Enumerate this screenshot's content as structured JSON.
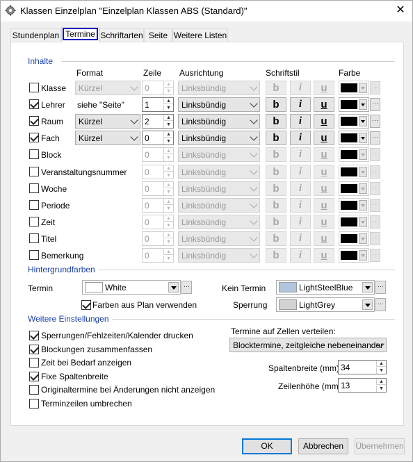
{
  "window": {
    "title": "Klassen Einzelplan \"Einzelplan Klassen ABS (Standard)\"",
    "close_glyph": "✕"
  },
  "tabs": [
    "Stundenplan",
    "Termine",
    "Schriftarten",
    "Seite",
    "Weitere Listen"
  ],
  "inhalte": {
    "group_title": "Inhalte",
    "headers": {
      "format": "Format",
      "zeile": "Zeile",
      "ausrichtung": "Ausrichtung",
      "schriftstil": "Schriftstil",
      "farbe": "Farbe"
    },
    "style_glyphs": {
      "bold": "b",
      "italic": "i",
      "underline": "u"
    },
    "dots": "···",
    "rows": [
      {
        "label": "Klasse",
        "checked": false,
        "format": "Kürzel",
        "format_type": "combo",
        "zeile": "0",
        "ausrichtung": "Linksbündig"
      },
      {
        "label": "Lehrer",
        "checked": true,
        "format": "siehe \"Seite\"",
        "format_type": "text",
        "zeile": "1",
        "ausrichtung": "Linksbündig"
      },
      {
        "label": "Raum",
        "checked": true,
        "format": "Kürzel",
        "format_type": "combo",
        "zeile": "2",
        "ausrichtung": "Linksbündig"
      },
      {
        "label": "Fach",
        "checked": true,
        "format": "Kürzel",
        "format_type": "combo",
        "zeile": "0",
        "ausrichtung": "Linksbündig"
      },
      {
        "label": "Block",
        "checked": false,
        "format": "",
        "format_type": "none",
        "zeile": "0",
        "ausrichtung": "Linksbündig"
      },
      {
        "label": "Veranstaltungsnummer",
        "checked": false,
        "format": "",
        "format_type": "none",
        "zeile": "0",
        "ausrichtung": "Linksbündig"
      },
      {
        "label": "Woche",
        "checked": false,
        "format": "",
        "format_type": "none",
        "zeile": "0",
        "ausrichtung": "Linksbündig"
      },
      {
        "label": "Periode",
        "checked": false,
        "format": "",
        "format_type": "none",
        "zeile": "0",
        "ausrichtung": "Linksbündig"
      },
      {
        "label": "Zeit",
        "checked": false,
        "format": "",
        "format_type": "none",
        "zeile": "0",
        "ausrichtung": "Linksbündig"
      },
      {
        "label": "Titel",
        "checked": false,
        "format": "",
        "format_type": "none",
        "zeile": "0",
        "ausrichtung": "Linksbündig"
      },
      {
        "label": "Bemerkung",
        "checked": false,
        "format": "",
        "format_type": "none",
        "zeile": "0",
        "ausrichtung": "Linksbündig"
      }
    ]
  },
  "hintergrund": {
    "group_title": "Hintergrundfarben",
    "termin_label": "Termin",
    "termin_value": "White",
    "termin_color": "#ffffff",
    "kein_termin_label": "Kein Termin",
    "kein_termin_value": "LightSteelBlue",
    "kein_termin_color": "#b0c4de",
    "sperrung_label": "Sperrung",
    "sperrung_value": "LightGrey",
    "sperrung_color": "#d3d3d3",
    "farben_checkbox": "Farben aus Plan verwenden",
    "farben_checked": true
  },
  "weitere": {
    "group_title": "Weitere Einstellungen",
    "options": [
      {
        "label": "Sperrungen/Fehlzeiten/Kalender drucken",
        "checked": true
      },
      {
        "label": "Blockungen zusammenfassen",
        "checked": true
      },
      {
        "label": "Zeit bei Bedarf anzeigen",
        "checked": false
      },
      {
        "label": "Fixe Spaltenbreite",
        "checked": true
      },
      {
        "label": "Originaltermine bei Änderungen nicht anzeigen",
        "checked": false
      },
      {
        "label": "Terminzeilen umbrechen",
        "checked": false
      }
    ],
    "verteilen_label": "Termine auf Zellen verteilen:",
    "verteilen_value": "Blocktermine, zeitgleiche nebeneinander",
    "spaltenbreite_label": "Spaltenbreite (mm)",
    "spaltenbreite_value": "34",
    "zeilenhoehe_label": "Zeilenhöhe (mm)",
    "zeilenhoehe_value": "13"
  },
  "buttons": {
    "ok": "OK",
    "abbrechen": "Abbrechen",
    "uebernehmen": "Übernehmen"
  }
}
